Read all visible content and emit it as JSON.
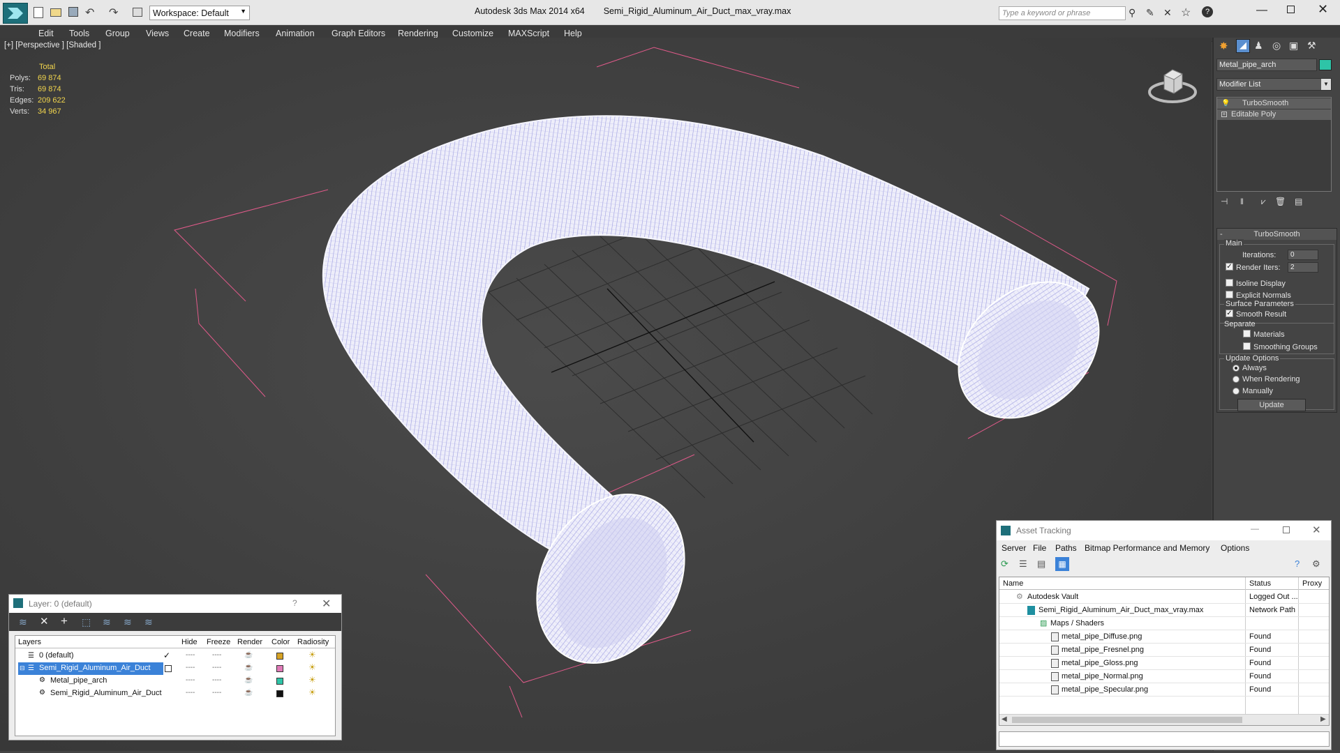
{
  "app": {
    "title": "Autodesk 3ds Max  2014 x64",
    "file": "Semi_Rigid_Aluminum_Air_Duct_max_vray.max",
    "workspace": "Workspace: Default",
    "search_placeholder": "Type a keyword or phrase"
  },
  "menu": [
    "Edit",
    "Tools",
    "Group",
    "Views",
    "Create",
    "Modifiers",
    "Animation",
    "Graph Editors",
    "Rendering",
    "Customize",
    "MAXScript",
    "Help"
  ],
  "viewport": {
    "label": "[+] [Perspective ] [Shaded ]",
    "stats": {
      "header": "Total",
      "rows": [
        {
          "label": "Polys:",
          "value": "69 874"
        },
        {
          "label": "Tris:",
          "value": "69 874"
        },
        {
          "label": "Edges:",
          "value": "209 622"
        },
        {
          "label": "Verts:",
          "value": "34 967"
        }
      ]
    }
  },
  "command_panel": {
    "object_name": "Metal_pipe_arch",
    "object_color": "#2ec4a7",
    "modifier_list": "Modifier List",
    "stack": [
      "TurboSmooth",
      "Editable Poly"
    ],
    "rollout_title": "TurboSmooth",
    "main_label": "Main",
    "iterations_label": "Iterations:",
    "iterations_value": "0",
    "render_iters_label": "Render Iters:",
    "render_iters_value": "2",
    "render_iters_checked": true,
    "isoline_label": "Isoline Display",
    "explicit_normals_label": "Explicit Normals",
    "surface_params_label": "Surface Parameters",
    "smooth_result_label": "Smooth Result",
    "separate_label": "Separate",
    "materials_label": "Materials",
    "smoothing_groups_label": "Smoothing Groups",
    "update_options_label": "Update Options",
    "always_label": "Always",
    "when_rendering_label": "When Rendering",
    "manually_label": "Manually",
    "update_button": "Update"
  },
  "layer_window": {
    "title": "Layer: 0 (default)",
    "columns": [
      "Layers",
      "Hide",
      "Freeze",
      "Render",
      "Color",
      "Radiosity"
    ],
    "rows": [
      {
        "name": "0 (default)",
        "color": "#d6a224",
        "selected": false,
        "indent": 0
      },
      {
        "name": "Semi_Rigid_Aluminum_Air_Duct",
        "color": "#e07ab8",
        "selected": true,
        "indent": 0
      },
      {
        "name": "Metal_pipe_arch",
        "color": "#2ec4a7",
        "selected": false,
        "indent": 1
      },
      {
        "name": "Semi_Rigid_Aluminum_Air_Duct",
        "color": "#111111",
        "selected": false,
        "indent": 1
      }
    ]
  },
  "asset_window": {
    "title": "Asset Tracking",
    "menu": [
      "Server",
      "File",
      "Paths",
      "Bitmap Performance and Memory",
      "Options"
    ],
    "columns": [
      "Name",
      "Status",
      "Proxy"
    ],
    "rows": [
      {
        "name": "Autodesk Vault",
        "status": "Logged Out ...",
        "indent": 1
      },
      {
        "name": "Semi_Rigid_Aluminum_Air_Duct_max_vray.max",
        "status": "Network Path",
        "indent": 2
      },
      {
        "name": "Maps / Shaders",
        "status": "",
        "indent": 3
      },
      {
        "name": "metal_pipe_Diffuse.png",
        "status": "Found",
        "indent": 4
      },
      {
        "name": "metal_pipe_Fresnel.png",
        "status": "Found",
        "indent": 4
      },
      {
        "name": "metal_pipe_Gloss.png",
        "status": "Found",
        "indent": 4
      },
      {
        "name": "metal_pipe_Normal.png",
        "status": "Found",
        "indent": 4
      },
      {
        "name": "metal_pipe_Specular.png",
        "status": "Found",
        "indent": 4
      }
    ]
  }
}
